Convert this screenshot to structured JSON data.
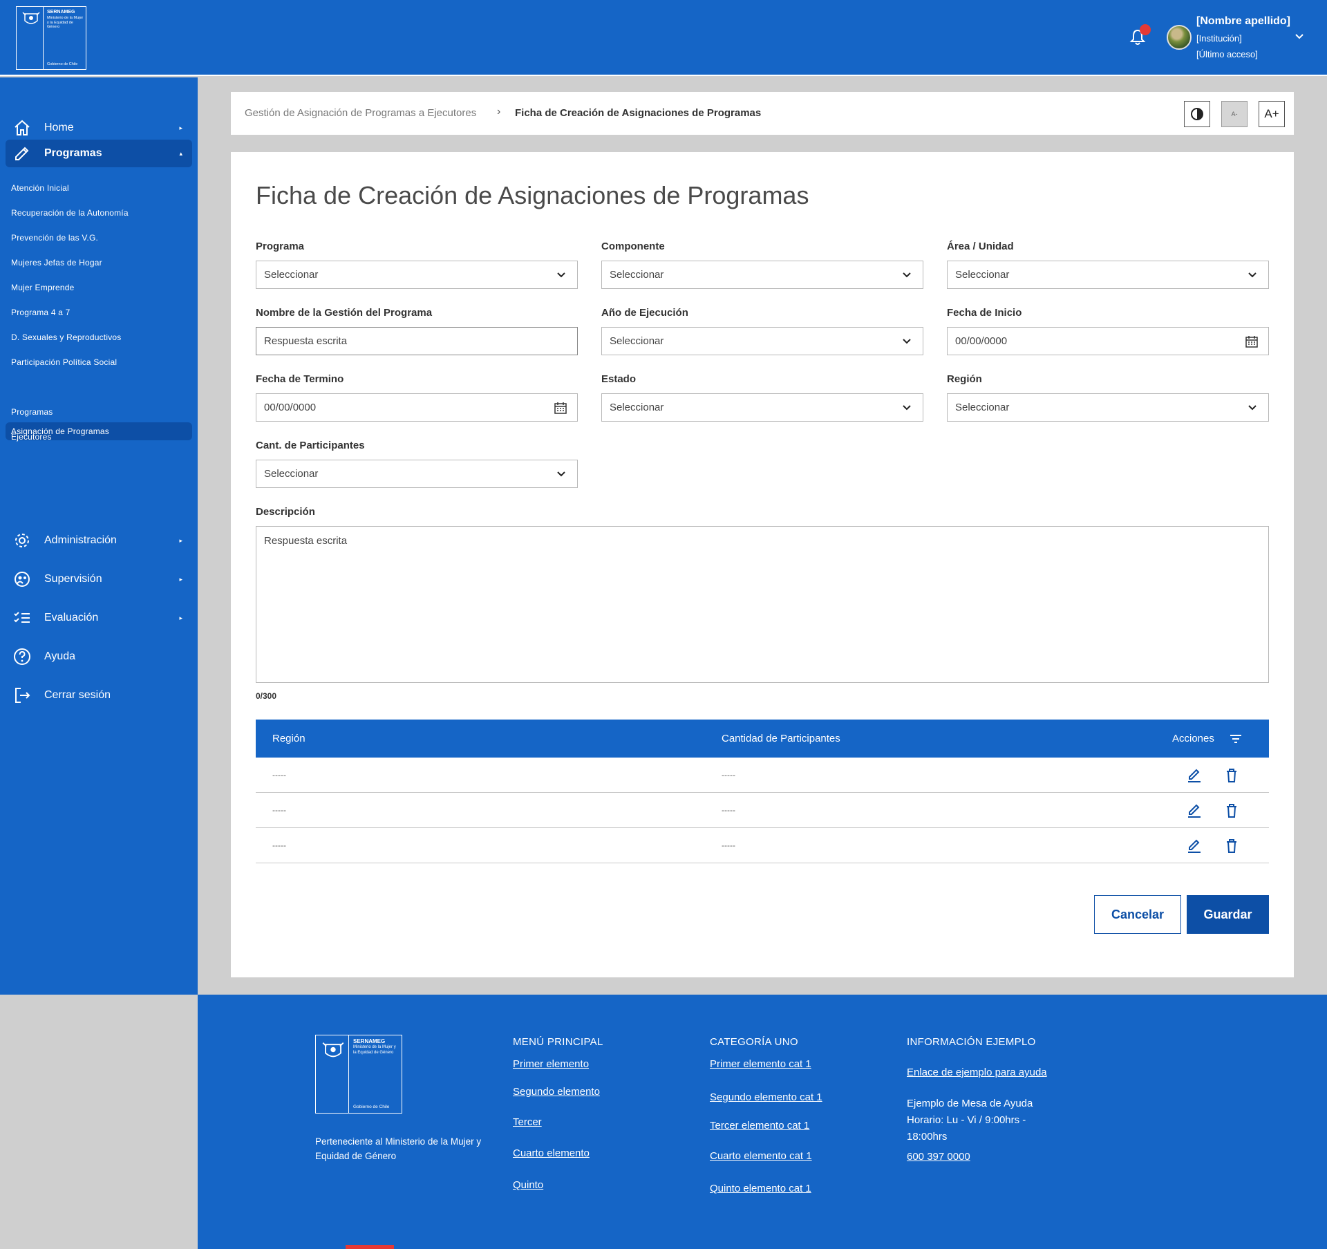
{
  "header": {
    "logo": {
      "org": "SERNAMEG",
      "ministry": "Ministerio de la Mujer y la Equidad de Género",
      "gov": "Gobierno de Chile"
    },
    "user": {
      "name": "[Nombre apellido]",
      "institution": "[Institución]",
      "last_access": "[Último acceso]"
    }
  },
  "sidebar": {
    "items": [
      {
        "label": "Home",
        "icon": "home-icon"
      },
      {
        "label": "Programas",
        "icon": "pencil-icon"
      },
      {
        "label": "Administración",
        "icon": "gear-icon"
      },
      {
        "label": "Supervisión",
        "icon": "supervision-icon"
      },
      {
        "label": "Evaluación",
        "icon": "checklist-icon"
      },
      {
        "label": "Ayuda",
        "icon": "help-icon"
      },
      {
        "label": "Cerrar sesión",
        "icon": "logout-icon"
      }
    ],
    "sub_items": [
      "Atención Inicial",
      "Recuperación de la Autonomía",
      "Prevención de las V.G.",
      "Mujeres Jefas de Hogar",
      "Mujer Emprende",
      "Programa 4 a 7",
      "D. Sexuales y Reproductivos",
      "Participación Política Social",
      "Asignación de Programas",
      "Programas",
      "Ejecutores"
    ]
  },
  "breadcrumb": {
    "parent": "Gestión de Asignación de Programas a Ejecutores",
    "current": "Ficha de Creación de Asignaciones de Programas",
    "font_decrease": "A-",
    "font_increase": "A+"
  },
  "form": {
    "title": "Ficha de Creación de Asignaciones de Programas",
    "fields": {
      "programa": {
        "label": "Programa",
        "value": "Seleccionar"
      },
      "componente": {
        "label": "Componente",
        "value": "Seleccionar"
      },
      "area": {
        "label": "Área / Unidad",
        "value": "Seleccionar"
      },
      "nombre": {
        "label": "Nombre de la Gestión del Programa",
        "value": "Respuesta escrita"
      },
      "anio": {
        "label": "Año de Ejecución",
        "value": "Seleccionar"
      },
      "fecha_inicio": {
        "label": "Fecha de Inicio",
        "value": "00/00/0000"
      },
      "fecha_termino": {
        "label": "Fecha de Termino",
        "value": "00/00/0000"
      },
      "estado": {
        "label": "Estado",
        "value": "Seleccionar"
      },
      "region": {
        "label": "Región",
        "value": "Seleccionar"
      },
      "cant": {
        "label": "Cant. de Participantes",
        "value": "Seleccionar"
      },
      "descripcion": {
        "label": "Descripción",
        "value": "Respuesta escrita",
        "counter": "0/300"
      }
    },
    "table": {
      "headers": [
        "Región",
        "Cantidad de Participantes",
        "Acciones"
      ],
      "rows": [
        [
          "-----",
          "-----"
        ],
        [
          "-----",
          "-----"
        ],
        [
          "-----",
          "-----"
        ]
      ]
    },
    "cancel_label": "Cancelar",
    "save_label": "Guardar"
  },
  "footer": {
    "logo": {
      "org": "SERNAMEG",
      "ministry": "Ministerio de la Mujer y la Equidad de Género",
      "gov": "Gobierno de Chile"
    },
    "description": "Perteneciente al Ministerio de la Mujer y Equidad de Género",
    "menu": {
      "title": "MENÚ PRINCIPAL",
      "links": [
        "Primer elemento",
        "Segundo elemento",
        "Tercer",
        "Cuarto elemento",
        "Quinto"
      ]
    },
    "cat": {
      "title": "CATEGORÍA UNO",
      "links": [
        "Primer elemento cat 1",
        "Segundo elemento cat 1",
        "Tercer elemento cat 1",
        "Cuarto elemento cat 1",
        "Quinto elemento cat 1"
      ]
    },
    "info": {
      "title": "INFORMACIÓN EJEMPLO",
      "link": "Enlace de ejemplo para ayuda",
      "text": "Ejemplo de Mesa de Ayuda Horario: Lu - Vi / 9:00hrs - 18:00hrs",
      "phone": "600 397 0000"
    }
  }
}
